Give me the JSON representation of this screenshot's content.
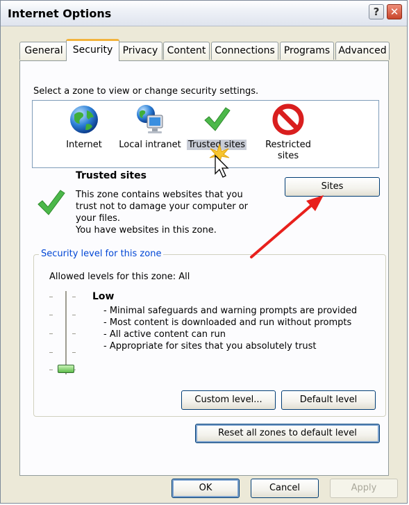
{
  "window": {
    "title": "Internet Options"
  },
  "title_buttons": {
    "help": "?",
    "close": "✕"
  },
  "tabs": [
    {
      "label": "General",
      "active": false
    },
    {
      "label": "Security",
      "active": true
    },
    {
      "label": "Privacy",
      "active": false
    },
    {
      "label": "Content",
      "active": false
    },
    {
      "label": "Connections",
      "active": false
    },
    {
      "label": "Programs",
      "active": false
    },
    {
      "label": "Advanced",
      "active": false
    }
  ],
  "security": {
    "zone_prompt": "Select a zone to view or change security settings.",
    "zones": [
      {
        "label": "Internet",
        "icon": "globe-icon"
      },
      {
        "label": "Local intranet",
        "icon": "computer-globe-icon"
      },
      {
        "label": "Trusted sites",
        "icon": "green-check-icon",
        "selected": true
      },
      {
        "label": "Restricted\nsites",
        "label_line1": "Restricted",
        "label_line2": "sites",
        "icon": "no-entry-icon"
      }
    ],
    "selected_zone": {
      "title": "Trusted sites",
      "desc1": "This zone contains websites that you",
      "desc2": "trust not to damage your computer or",
      "desc3": "your files.",
      "desc4": "You have websites in this zone."
    },
    "sites_button": "Sites",
    "level_group": {
      "legend": "Security level for this zone",
      "allowed": "Allowed levels for this zone: All",
      "level_name": "Low",
      "slider_level": 0,
      "bullets": [
        "- Minimal safeguards and warning prompts are provided",
        "- Most content is downloaded and run without prompts",
        "- All active content can run",
        "- Appropriate for sites that you absolutely trust"
      ],
      "custom_button": "Custom level...",
      "default_button": "Default level"
    },
    "reset_button": "Reset all zones to default level"
  },
  "footer": {
    "ok": "OK",
    "cancel": "Cancel",
    "apply": "Apply"
  },
  "colors": {
    "accent": "#0046d5",
    "annotation_arrow": "#e8201c",
    "tab_highlight": "#f2b33d"
  }
}
